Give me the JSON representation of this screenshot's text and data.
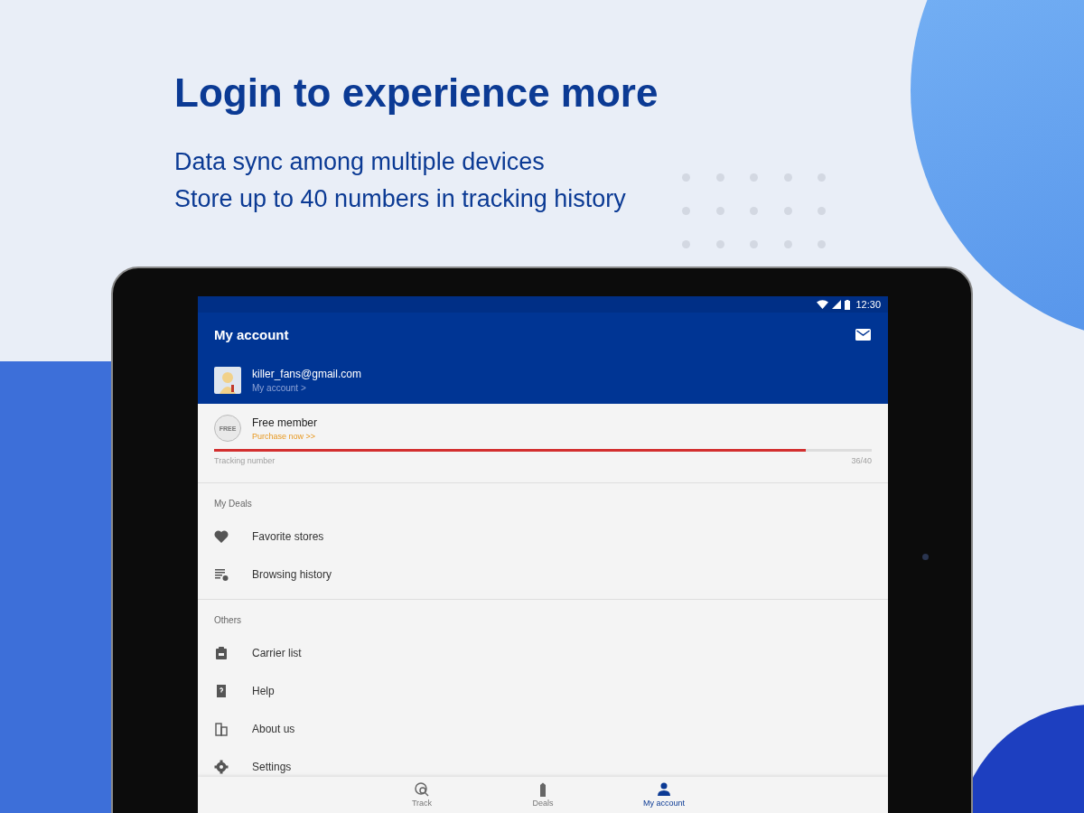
{
  "promo": {
    "headline": "Login to experience more",
    "lines": [
      "Data sync among multiple devices",
      "Store up to 40 numbers in tracking history"
    ]
  },
  "status_bar": {
    "time": "12:30"
  },
  "toolbar": {
    "title": "My account"
  },
  "account": {
    "email": "killer_fans@gmail.com",
    "link": "My account >"
  },
  "membership": {
    "badge": "FREE",
    "title": "Free member",
    "action": "Purchase now >>",
    "meter_label": "Tracking number",
    "level": 0.9,
    "count": "36/40"
  },
  "sections": [
    {
      "title": "My Deals",
      "items": [
        {
          "label": "Favorite stores",
          "kind": "heart"
        },
        {
          "label": "Browsing history",
          "kind": "history"
        }
      ]
    },
    {
      "title": "Others",
      "items": [
        {
          "label": "Carrier list",
          "kind": "carrier"
        },
        {
          "label": "Help",
          "kind": "help"
        },
        {
          "label": "About us",
          "kind": "building"
        },
        {
          "label": "Settings",
          "kind": "gear"
        }
      ]
    }
  ],
  "bottom_nav": [
    {
      "label": "Track",
      "kind": "track",
      "selected": false
    },
    {
      "label": "Deals",
      "kind": "deals",
      "selected": false
    },
    {
      "label": "My account",
      "kind": "person",
      "selected": true
    }
  ]
}
